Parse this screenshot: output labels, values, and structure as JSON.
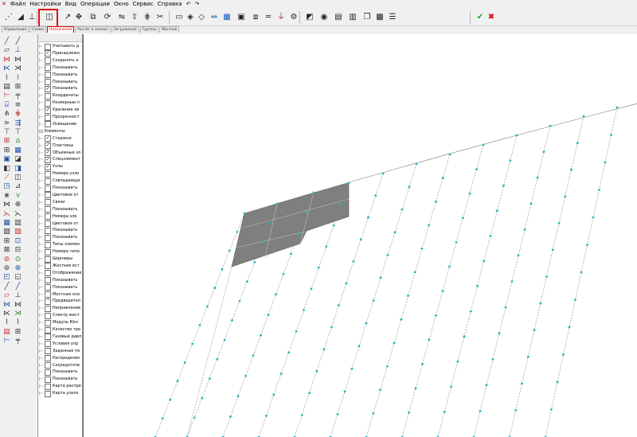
{
  "menu": [
    "Файл",
    "Настройки",
    "Вид",
    "Операции",
    "Окно",
    "Сервис",
    "Справка"
  ],
  "tabs": [
    "Управление",
    "Схема",
    "Назначения",
    "Расчёт и анализ",
    "Загружения",
    "Группы",
    "Монтаж"
  ],
  "tree": [
    {
      "label": "Учитывать д",
      "checked": false,
      "group": false
    },
    {
      "label": "Принадлежн",
      "checked": true,
      "group": false
    },
    {
      "label": "Сохранять о",
      "checked": false,
      "group": false
    },
    {
      "label": "Показывать",
      "checked": false,
      "group": false
    },
    {
      "label": "Показывать",
      "checked": false,
      "group": false
    },
    {
      "label": "Показывать",
      "checked": false,
      "group": false
    },
    {
      "label": "Показывать",
      "checked": true,
      "group": false
    },
    {
      "label": "Координаты",
      "checked": false,
      "group": false
    },
    {
      "label": "Размерные л",
      "checked": false,
      "group": false
    },
    {
      "label": "Удаление ли",
      "checked": true,
      "group": false
    },
    {
      "label": "Прозрачност",
      "checked": false,
      "group": false
    },
    {
      "label": "Освещение",
      "checked": false,
      "group": false
    },
    {
      "label": "Элементы",
      "checked": false,
      "group": true
    },
    {
      "label": "Стержни",
      "checked": true,
      "group": false
    },
    {
      "label": "Пластины",
      "checked": true,
      "group": false
    },
    {
      "label": "Объемные эл",
      "checked": true,
      "group": false
    },
    {
      "label": "Спецэлемент",
      "checked": true,
      "group": false
    },
    {
      "label": "Узлы",
      "checked": true,
      "group": false
    },
    {
      "label": "Номера узло",
      "checked": false,
      "group": false
    },
    {
      "label": "Совпадающи",
      "checked": false,
      "group": false
    },
    {
      "label": "Показывать",
      "checked": false,
      "group": false
    },
    {
      "label": "Цветовое от",
      "checked": false,
      "group": false
    },
    {
      "label": "Связи",
      "checked": false,
      "group": false
    },
    {
      "label": "Показывать",
      "checked": false,
      "group": false
    },
    {
      "label": "Номера эле",
      "checked": false,
      "group": false
    },
    {
      "label": "Цветовое от",
      "checked": false,
      "group": false
    },
    {
      "label": "Показывать",
      "checked": false,
      "group": false
    },
    {
      "label": "Показывать",
      "checked": false,
      "group": false
    },
    {
      "label": "Типы элемен",
      "checked": false,
      "group": false
    },
    {
      "label": "Номера типо",
      "checked": false,
      "group": false
    },
    {
      "label": "Шарниры",
      "checked": false,
      "group": false
    },
    {
      "label": "Жесткие вст",
      "checked": false,
      "group": false
    },
    {
      "label": "Отображение",
      "checked": false,
      "group": false
    },
    {
      "label": "Показывать",
      "checked": false,
      "group": false
    },
    {
      "label": "Показывать",
      "checked": false,
      "group": false
    },
    {
      "label": "Местные оси",
      "checked": false,
      "group": false
    },
    {
      "label": "Предварител",
      "checked": false,
      "group": false
    },
    {
      "label": "Направление",
      "checked": false,
      "group": false
    },
    {
      "label": "Спектр жест",
      "checked": false,
      "group": false
    },
    {
      "label": "Модуль Юнг",
      "checked": false,
      "group": false
    },
    {
      "label": "Качество тре",
      "checked": false,
      "group": false
    },
    {
      "label": "Газовые давл",
      "checked": false,
      "group": false
    },
    {
      "label": "Условия упр",
      "checked": false,
      "group": false
    },
    {
      "label": "Заданные по",
      "checked": false,
      "group": false
    },
    {
      "label": "Распределен",
      "checked": false,
      "group": false
    },
    {
      "label": "Сосредоточе",
      "checked": false,
      "group": false
    },
    {
      "label": "Показывать",
      "checked": false,
      "group": false
    },
    {
      "label": "Показывать",
      "checked": false,
      "group": false
    },
    {
      "label": "Карта распре",
      "checked": false,
      "group": false
    },
    {
      "label": "Карта усило",
      "checked": false,
      "group": false
    }
  ],
  "toolbar_icons": [
    "nodes-icon",
    "element-icon",
    "support-icon",
    "select-element-icon",
    "arrow-icon",
    "move-icon",
    "copy-icon",
    "rotate-icon",
    "mirror-icon",
    "extrude-icon",
    "divide-icon",
    "delete-icon",
    "rectangle-icon",
    "cube-icon",
    "shell-icon",
    "dimension-icon",
    "mesh-icon",
    "plate-icon",
    "copy-plate-icon",
    "beam-icon",
    "filter-icon",
    "settings-icon",
    "stiffness-icon",
    "hinge-icon",
    "rigid-icon",
    "table-icon",
    "copy-icon",
    "save-icon",
    "layers-icon",
    "apply-icon",
    "cancel-icon"
  ],
  "colors": {
    "selected_fill": "#7f7f7f",
    "mesh_line": "#8a8a8a",
    "node": "#1fb9c6",
    "highlight": "#e01010",
    "background": "#ffffff"
  }
}
